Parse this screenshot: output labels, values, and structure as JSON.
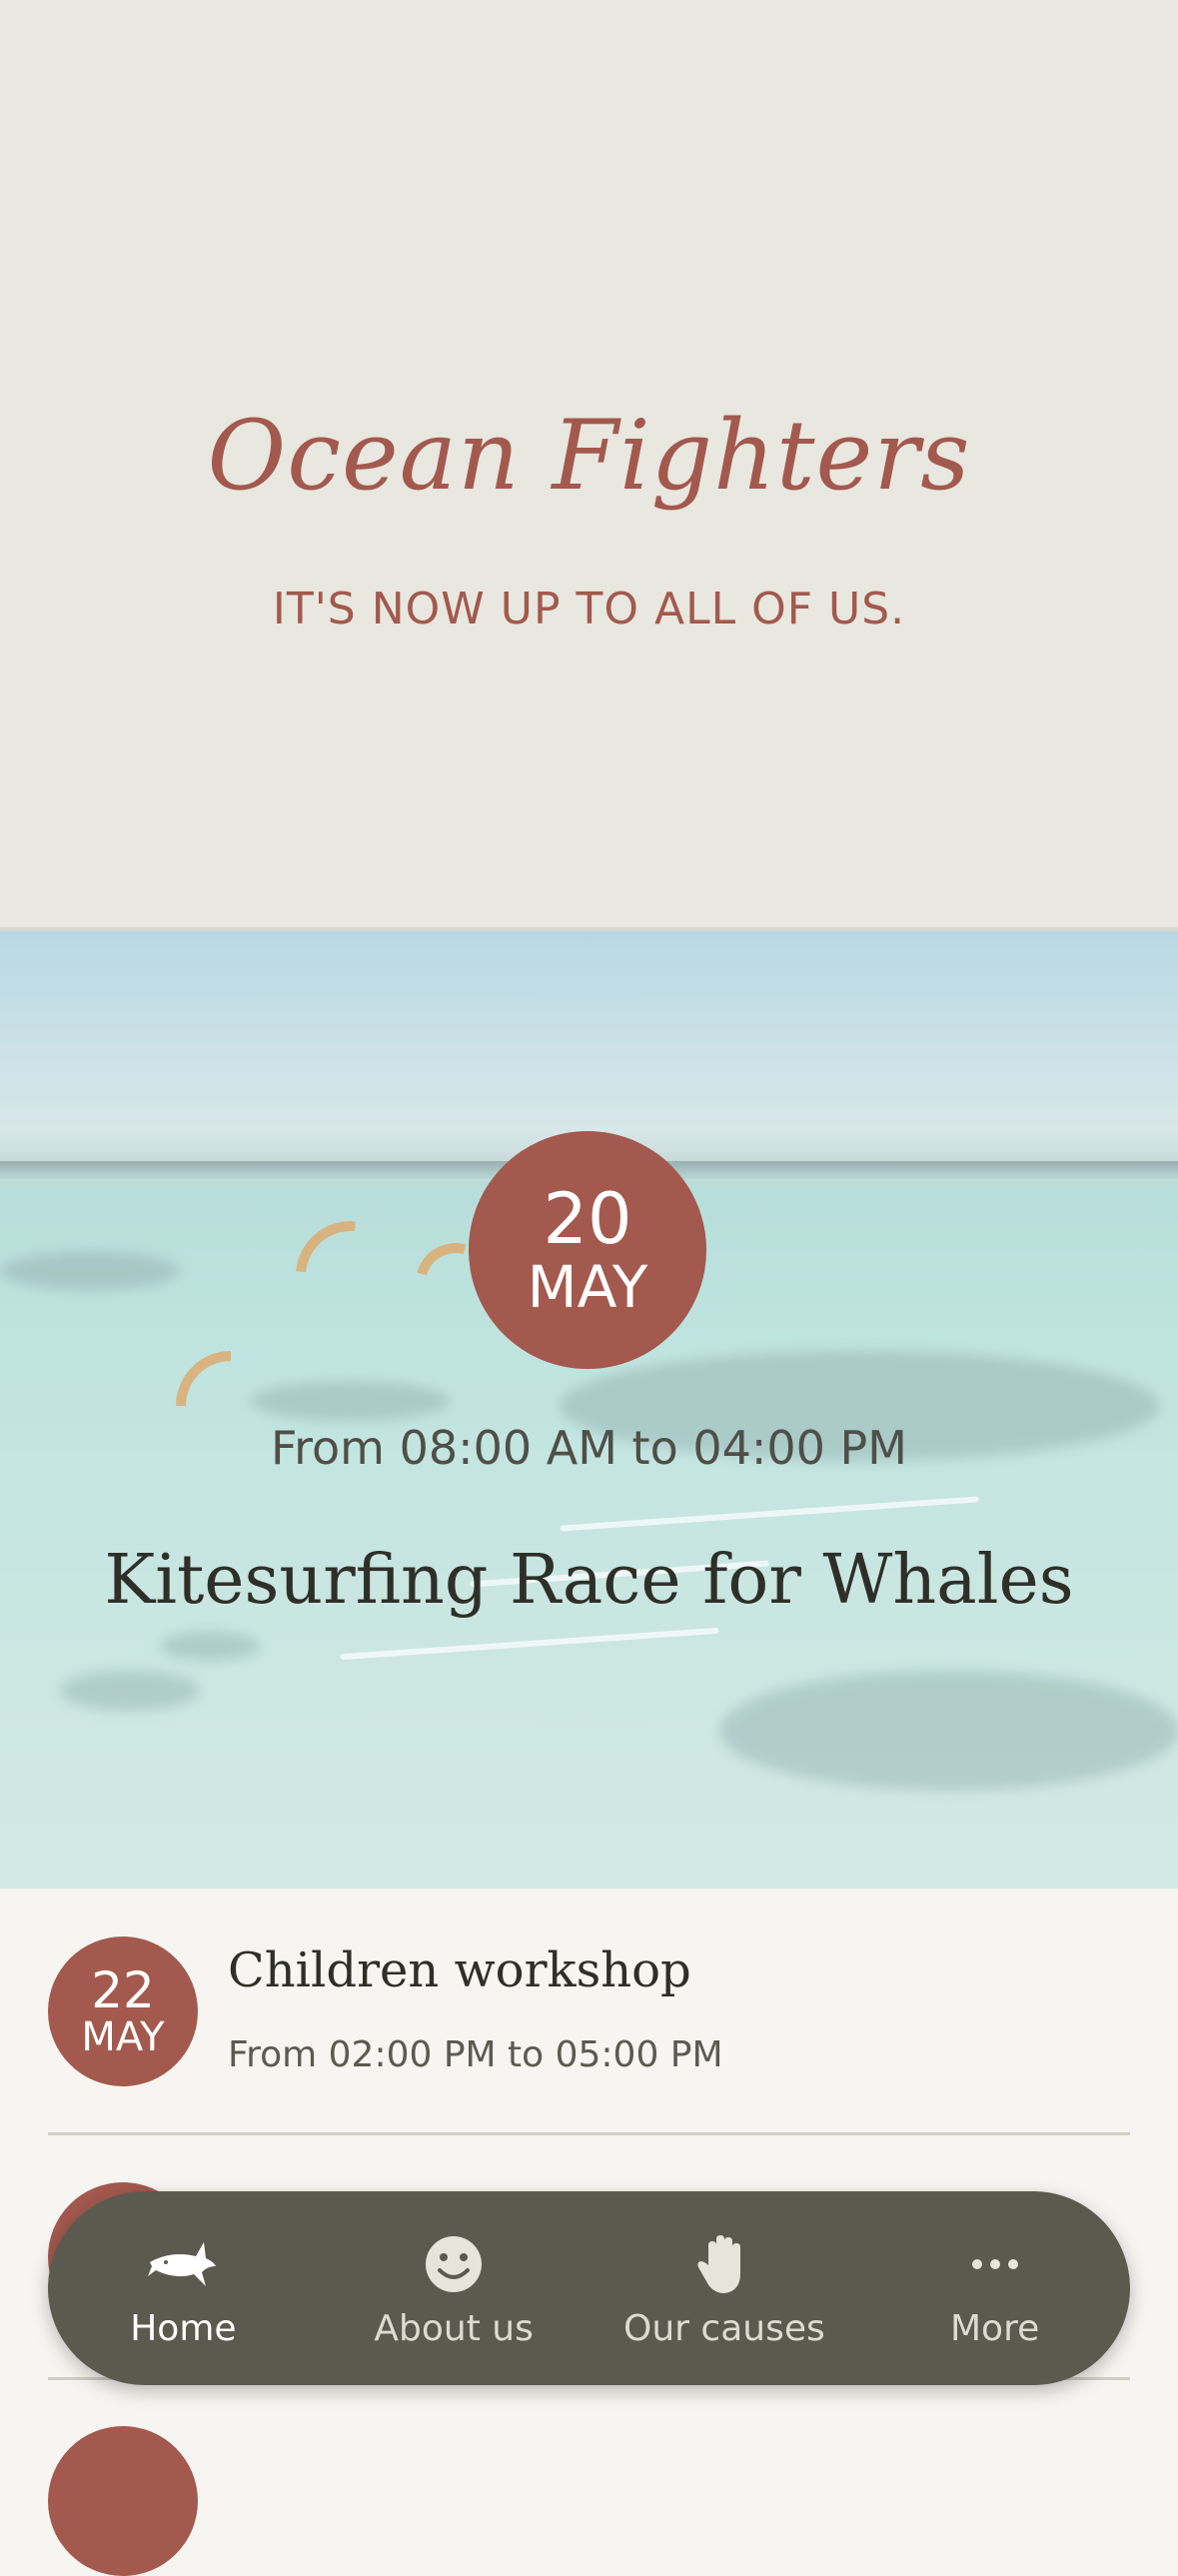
{
  "header": {
    "title": "Ocean Fighters",
    "tagline": "IT'S NOW UP TO ALL OF US."
  },
  "featured_event": {
    "day": "20",
    "month": "MAY",
    "time": "From 08:00 AM to 04:00 PM",
    "title": "Kitesurfing Race for Whales"
  },
  "events": [
    {
      "day": "22",
      "month": "MAY",
      "title": "Children workshop",
      "time": "From 02:00 PM to 05:00 PM"
    }
  ],
  "tabbar": {
    "tabs": [
      {
        "label": "Home",
        "icon": "shark-icon",
        "active": true
      },
      {
        "label": "About us",
        "icon": "smiley-icon",
        "active": false
      },
      {
        "label": "Our causes",
        "icon": "hand-icon",
        "active": false
      },
      {
        "label": "More",
        "icon": "more-dots-icon",
        "active": false
      }
    ]
  },
  "colors": {
    "accent": "#a3594d",
    "header_bg": "#e8e7e0",
    "tabbar_bg": "#5b5a4e",
    "page_bg": "#f6f5f1"
  }
}
